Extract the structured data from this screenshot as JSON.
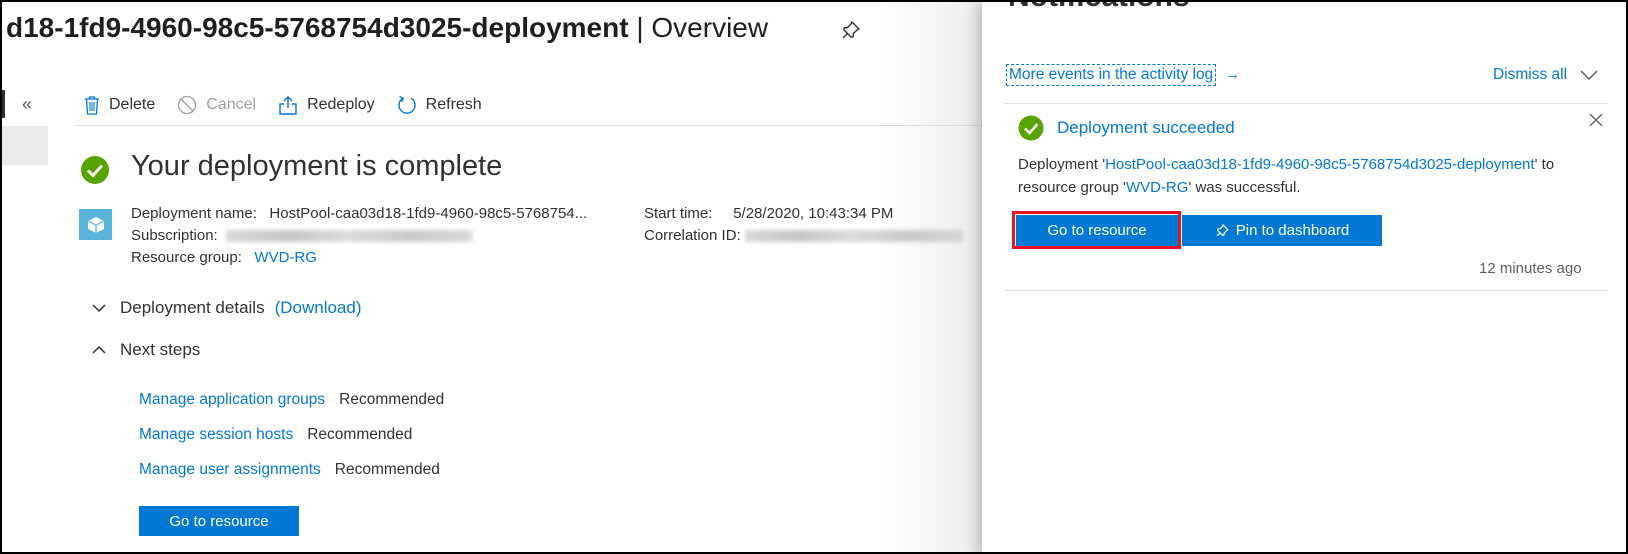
{
  "header": {
    "title_name": "d18-1fd9-4960-98c5-5768754d3025-deployment",
    "title_separator": " | ",
    "title_suffix": "Overview"
  },
  "nav": {
    "collapse_glyph": "«"
  },
  "toolbar": {
    "delete_label": "Delete",
    "cancel_label": "Cancel",
    "redeploy_label": "Redeploy",
    "refresh_label": "Refresh"
  },
  "deployment": {
    "complete_title": "Your deployment is complete",
    "name_label": "Deployment name:",
    "name_value": "HostPool-caa03d18-1fd9-4960-98c5-5768754...",
    "subscription_label": "Subscription:",
    "resource_group_label": "Resource group:",
    "resource_group_value": "WVD-RG",
    "start_time_label": "Start time:",
    "start_time_value": "5/28/2020, 10:43:34 PM",
    "correlation_label": "Correlation ID:"
  },
  "sections": {
    "details_label": "Deployment details",
    "download_link": "(Download)",
    "next_steps_label": "Next steps"
  },
  "next_steps": [
    {
      "link": "Manage application groups",
      "tag": "Recommended"
    },
    {
      "link": "Manage session hosts",
      "tag": "Recommended"
    },
    {
      "link": "Manage user assignments",
      "tag": "Recommended"
    }
  ],
  "main_go_to_resource": "Go to resource",
  "notifications": {
    "title": "Notifications",
    "activity_link": "More events in the activity log",
    "activity_arrow": "→",
    "dismiss_all": "Dismiss all",
    "item": {
      "title": "Deployment succeeded",
      "msg_prefix": "Deployment '",
      "msg_deployment": "HostPool-caa03d18-1fd9-4960-98c5-5768754d3025-deployment",
      "msg_middle": "' to resource group '",
      "msg_rg": "WVD-RG",
      "msg_suffix": "' was successful.",
      "go_to_resource": "Go to resource",
      "pin_to_dashboard": "Pin to dashboard",
      "time": "12 minutes ago"
    }
  },
  "colors": {
    "accent": "#0078d4",
    "success": "#57a300",
    "highlight": "#e81123"
  }
}
